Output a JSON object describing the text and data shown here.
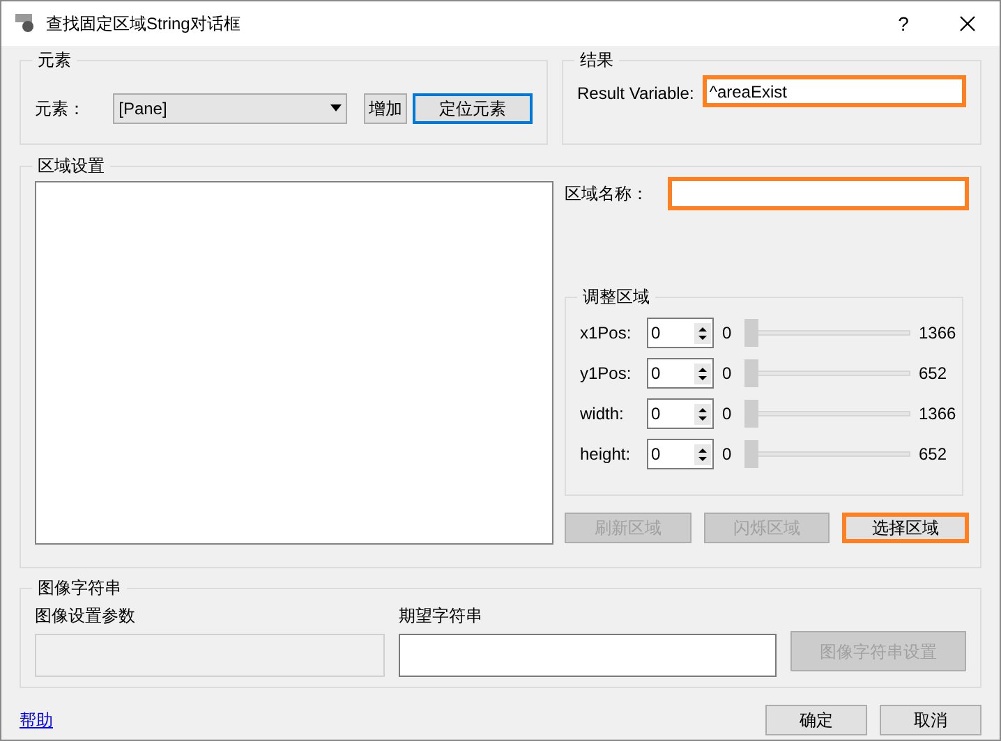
{
  "window": {
    "title": "查找固定区域String对话框",
    "help_button": "?"
  },
  "element_group": {
    "legend": "元素",
    "label": "元素：",
    "dropdown": "[Pane]",
    "add_button": "增加",
    "locate_button": {
      "label": "定位元素",
      "default": true
    }
  },
  "result_group": {
    "legend": "结果",
    "label": "Result Variable:",
    "value": "^areaExist",
    "highlighted": true
  },
  "area_group": {
    "legend": "区域设置",
    "name_label": "区域名称：",
    "name_highlighted": true,
    "adjust": {
      "legend": "调整区域",
      "params": [
        {
          "label": "x1Pos:",
          "value": "0",
          "min": "0",
          "level": 0,
          "max": "1366"
        },
        {
          "label": "y1Pos:",
          "value": "0",
          "min": "0",
          "level": 0,
          "max": "652"
        },
        {
          "label": "width:",
          "value": "0",
          "min": "0",
          "level": 0,
          "max": "1366"
        },
        {
          "label": "height:",
          "value": "0",
          "min": "0",
          "level": 0,
          "max": "652"
        }
      ]
    },
    "buttons": [
      {
        "label": "刷新区域",
        "disabled": true,
        "highlighted": false
      },
      {
        "label": "闪烁区域",
        "disabled": true,
        "highlighted": false
      },
      {
        "label": "选择区域",
        "disabled": false,
        "highlighted": true
      }
    ]
  },
  "image_group": {
    "legend": "图像字符串",
    "params_label": "图像设置参数",
    "expected_label": "期望字符串",
    "settings_button": {
      "label": "图像字符串设置",
      "disabled": true
    }
  },
  "help_link": "帮助",
  "buttons": [
    "确定",
    "取消"
  ]
}
